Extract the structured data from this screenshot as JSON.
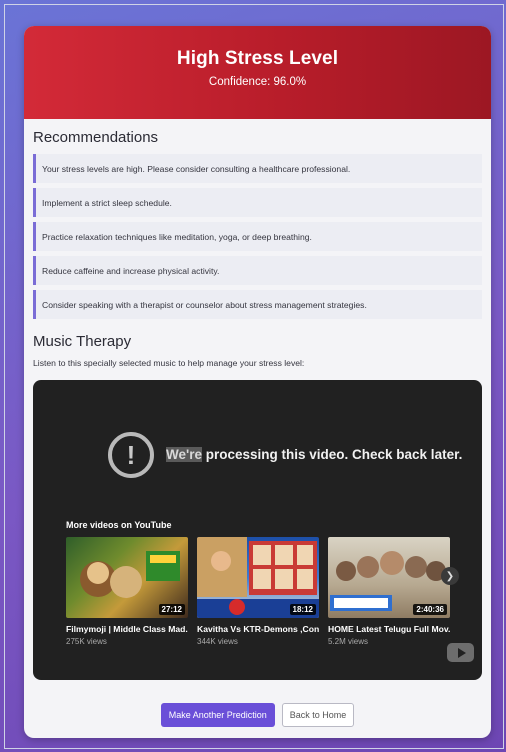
{
  "result": {
    "title": "High Stress Level",
    "confidence": "Confidence: 96.0%",
    "header_color": "#c51f2e"
  },
  "recommendations": {
    "heading": "Recommendations",
    "items": [
      "Your stress levels are high. Please consider consulting a healthcare professional.",
      "Implement a strict sleep schedule.",
      "Practice relaxation techniques like meditation, yoga, or deep breathing.",
      "Reduce caffeine and increase physical activity.",
      "Consider speaking with a therapist or counselor about stress management strategies."
    ]
  },
  "music": {
    "heading": "Music Therapy",
    "subtitle": "Listen to this specially selected music to help manage your stress level:",
    "player": {
      "error_highlight": "We're",
      "error_rest": " processing this video. Check back later.",
      "more_videos_label": "More videos on YouTube",
      "videos": [
        {
          "title": "Filmymoji | Middle Class Mad...",
          "views": "275K views",
          "duration": "27:12"
        },
        {
          "title": "Kavitha Vs KTR-Demons ,Con...",
          "views": "344K views",
          "duration": "18:12"
        },
        {
          "title": "HOME Latest Telugu Full Mov...",
          "views": "5.2M views",
          "duration": "2:40:36"
        }
      ]
    }
  },
  "actions": {
    "primary": "Make Another Prediction",
    "secondary": "Back to Home"
  },
  "colors": {
    "accent": "#6a4fd8",
    "danger": "#c51f2e"
  }
}
